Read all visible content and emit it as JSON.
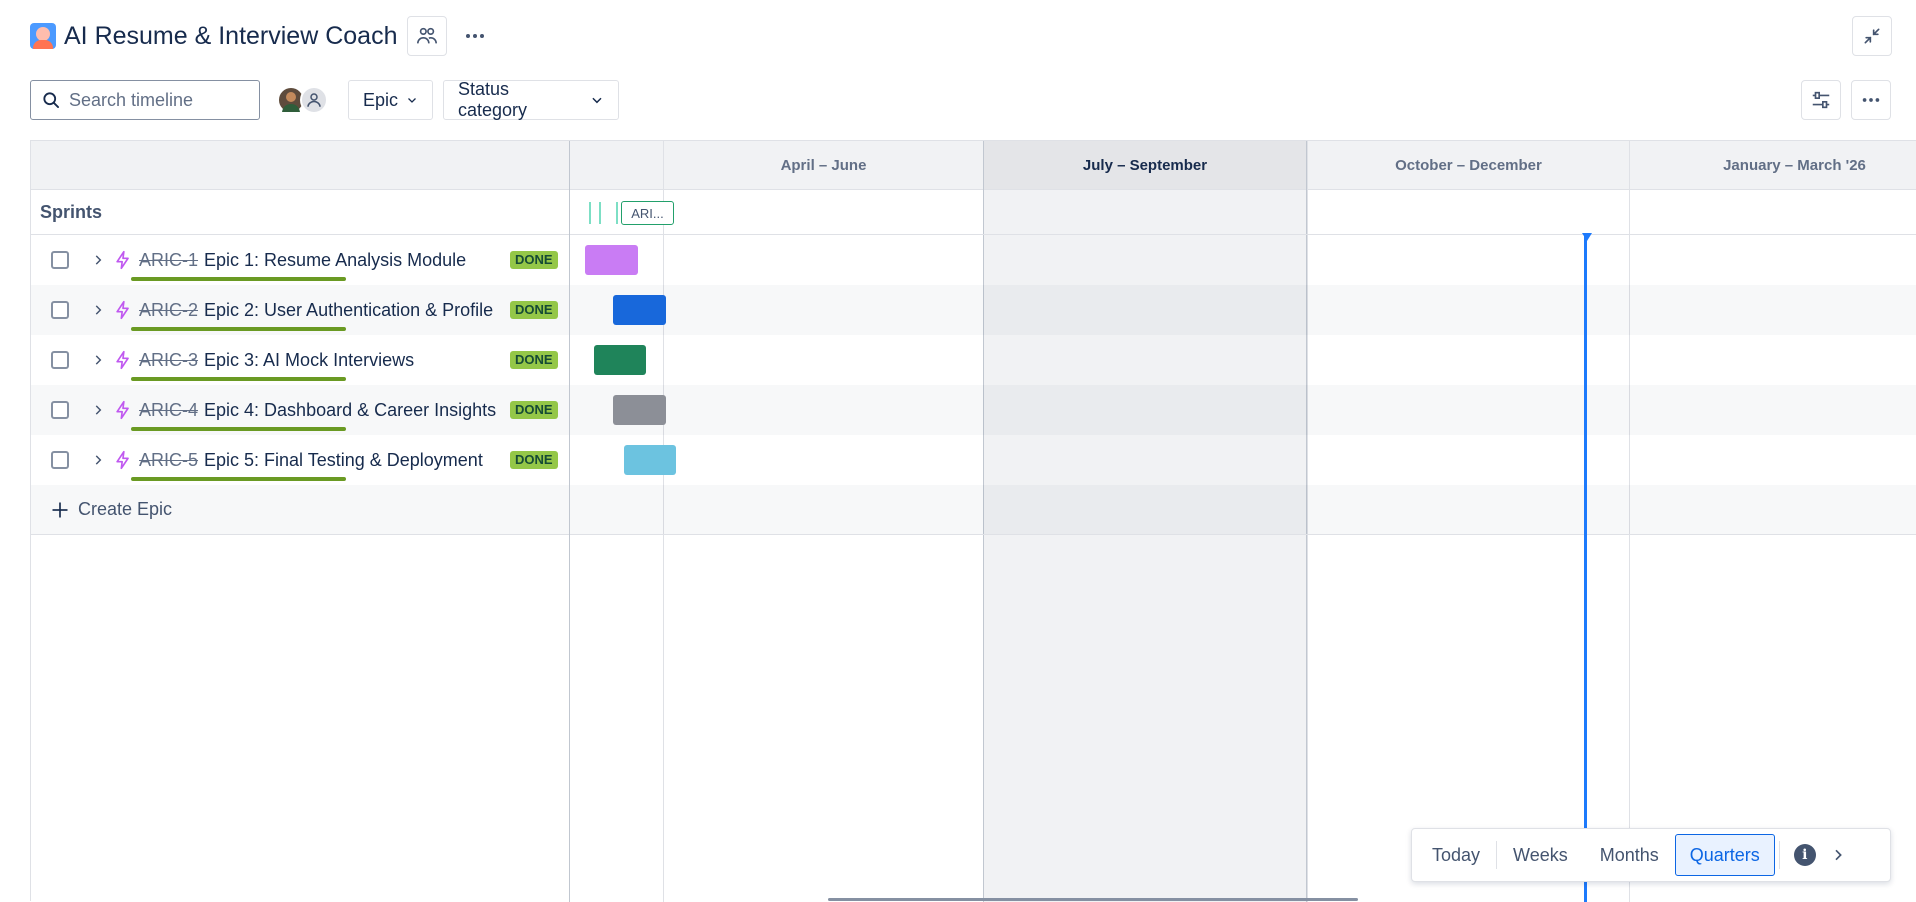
{
  "header": {
    "title": "AI Resume & Interview Coach",
    "logo_icon": "project-avatar-icon",
    "team_icon": "people-icon",
    "more_icon": "ellipsis-icon",
    "collapse_icon": "collapse-diagonal-icon"
  },
  "toolbar": {
    "search_placeholder": "Search timeline",
    "filter_epic": "Epic",
    "filter_status": "Status category",
    "avatars": [
      "user-avatar-photo",
      "unassigned-avatar"
    ],
    "settings_icon": "sliders-icon",
    "more_icon": "ellipsis-icon"
  },
  "timeline": {
    "sprints_label": "Sprints",
    "sprint_chip": "ARI...",
    "quarters": [
      {
        "label": "April – June",
        "current": false
      },
      {
        "label": "July – September",
        "current": true
      },
      {
        "label": "October – December",
        "current": false
      },
      {
        "label": "January – March '26",
        "current": false
      }
    ],
    "epics": [
      {
        "key": "ARIC-1",
        "summary": "Epic 1: Resume Analysis Module",
        "status": "DONE",
        "color": "#c97cf4",
        "progress": 1.0
      },
      {
        "key": "ARIC-2",
        "summary": "Epic 2: User Authentication & Profile",
        "status": "DONE",
        "color": "#1868db",
        "progress": 1.0
      },
      {
        "key": "ARIC-3",
        "summary": "Epic 3: AI Mock Interviews",
        "status": "DONE",
        "color": "#1f845a",
        "progress": 1.0
      },
      {
        "key": "ARIC-4",
        "summary": "Epic 4: Dashboard & Career Insights",
        "status": "DONE",
        "color": "#8c8f97",
        "progress": 1.0
      },
      {
        "key": "ARIC-5",
        "summary": "Epic 5: Final Testing & Deployment",
        "status": "DONE",
        "color": "#6cc3e0",
        "progress": 1.0
      }
    ],
    "create_label": "Create Epic"
  },
  "zoom": {
    "today": "Today",
    "weeks": "Weeks",
    "months": "Months",
    "quarters": "Quarters",
    "active": "Quarters",
    "info_icon": "info-icon",
    "next_icon": "chevron-right-icon"
  },
  "colors": {
    "accent": "#0c66e4",
    "today_line": "#1d7afc",
    "done_lozenge": "#94c748"
  }
}
